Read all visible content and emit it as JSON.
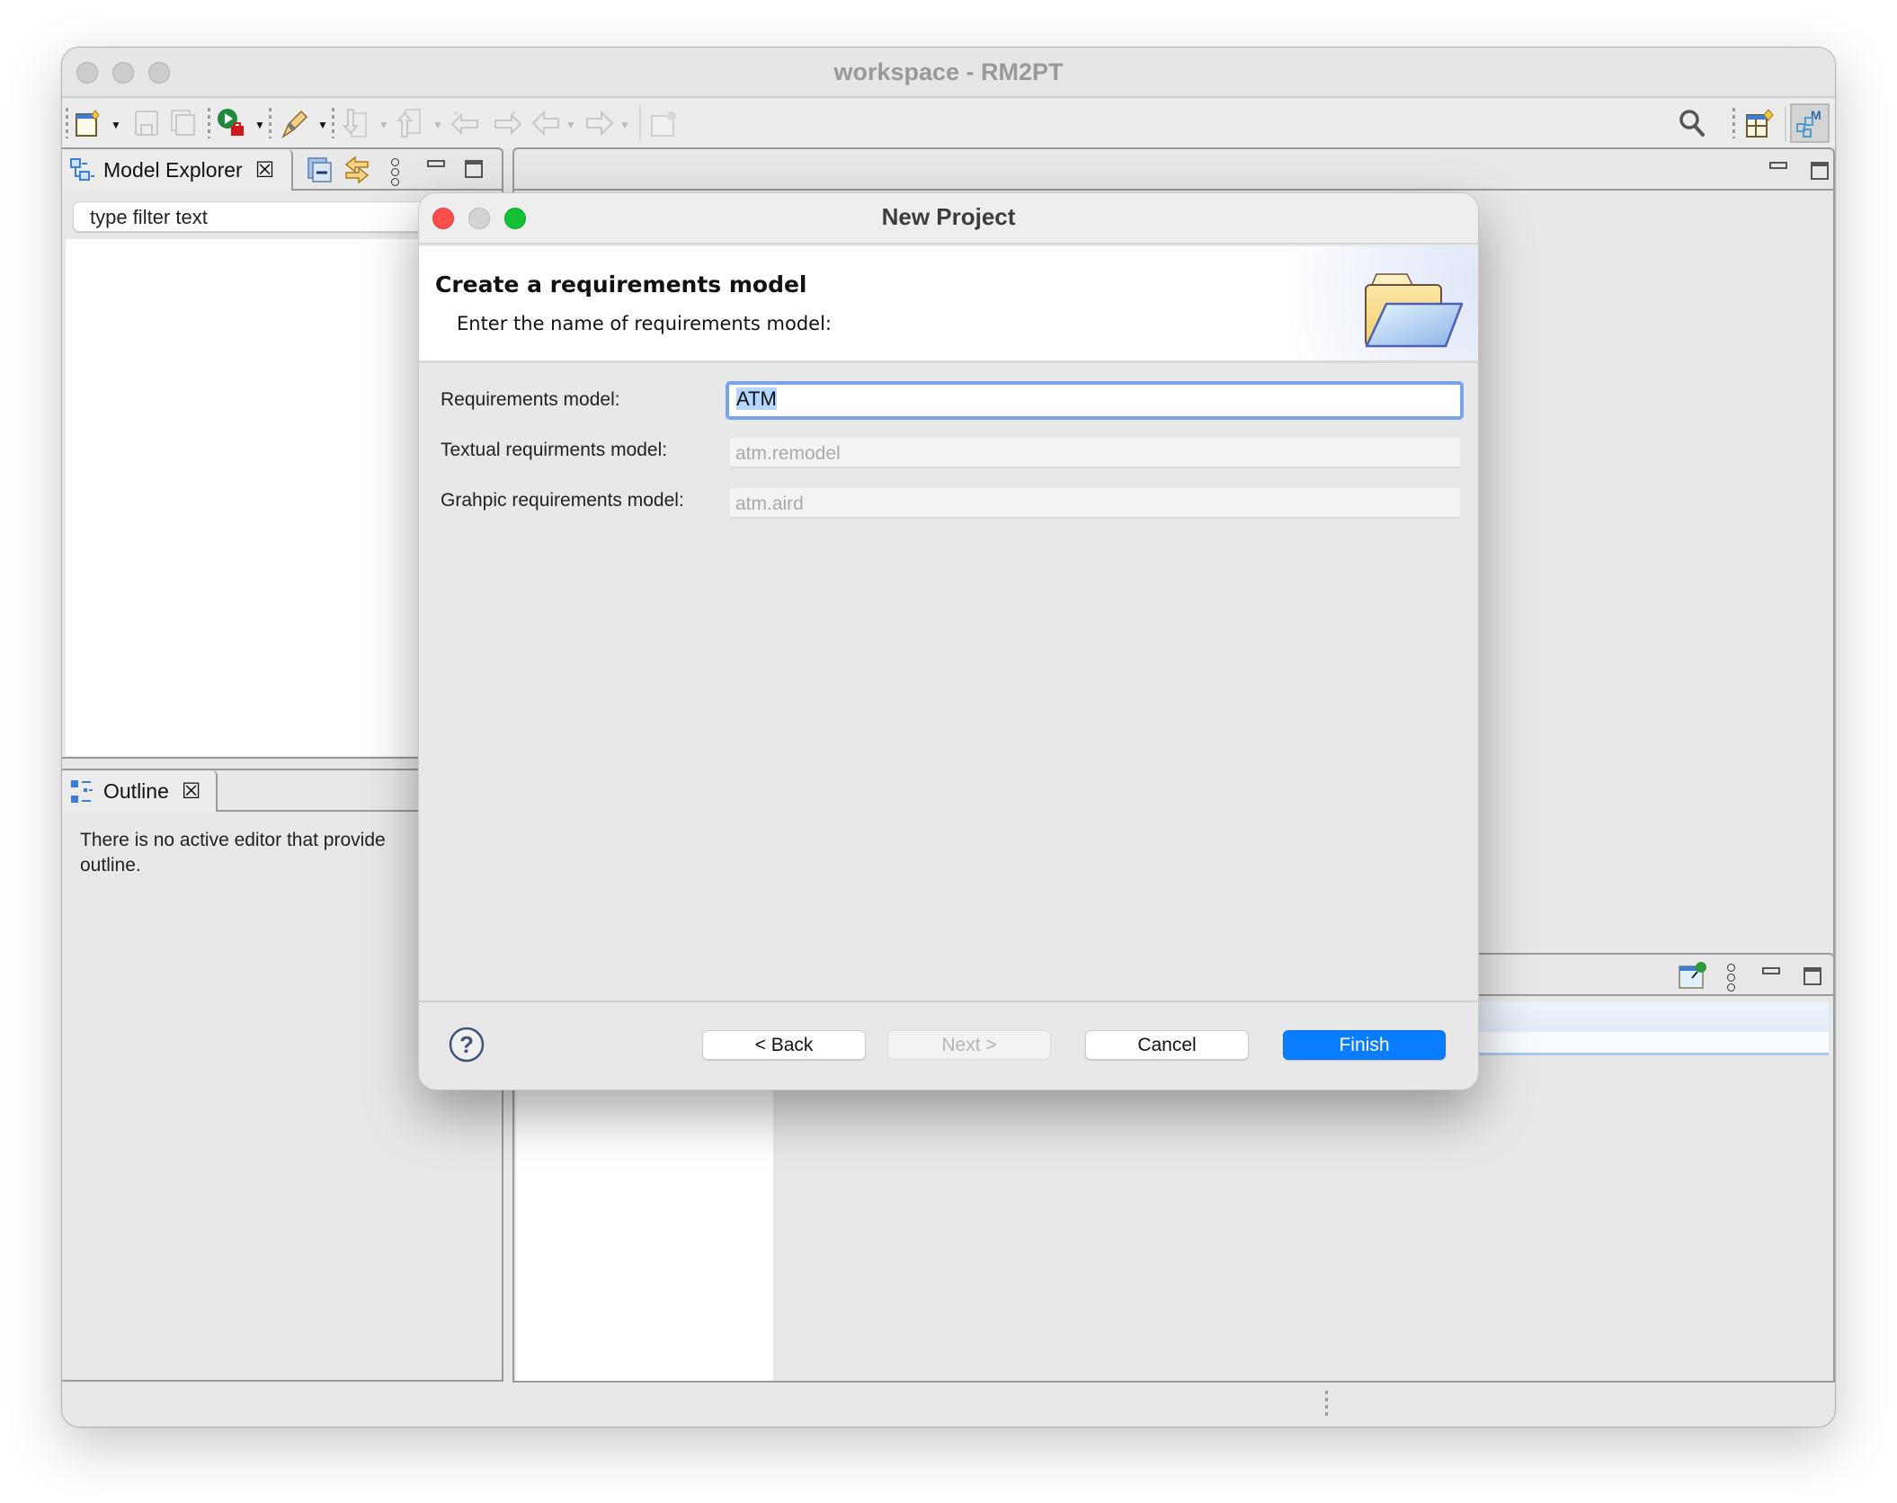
{
  "window": {
    "title": "workspace - RM2PT"
  },
  "toolbar": {
    "icons": [
      "new-wizard-icon",
      "save-icon",
      "save-all-icon",
      "run-icon",
      "pen-tool-icon",
      "next-annotation-icon",
      "previous-annotation-icon",
      "last-edit-location-icon",
      "forward-edit-icon",
      "back-icon",
      "forward-icon",
      "pin-editor-icon",
      "search-icon",
      "open-perspective-icon",
      "modeling-perspective-icon"
    ]
  },
  "model_explorer": {
    "tab_label": "Model Explorer",
    "filter_placeholder": "type filter text"
  },
  "outline": {
    "tab_label": "Outline",
    "message_line1": "There is no active editor that provide",
    "message_line2": "outline."
  },
  "dialog": {
    "title": "New Project",
    "header_title": "Create a requirements model",
    "header_subtitle": "Enter the name of requirements model:",
    "fields": [
      {
        "label": "Requirements model:",
        "value": "ATM",
        "editable": true,
        "selected": true
      },
      {
        "label": "Textual requirments model:",
        "value": "atm.remodel",
        "editable": false
      },
      {
        "label": "Grahpic requirements model:",
        "value": "atm.aird",
        "editable": false
      }
    ],
    "buttons": {
      "back": "< Back",
      "next": "Next >",
      "cancel": "Cancel",
      "finish": "Finish"
    },
    "accent_color": "#0a7cff"
  }
}
